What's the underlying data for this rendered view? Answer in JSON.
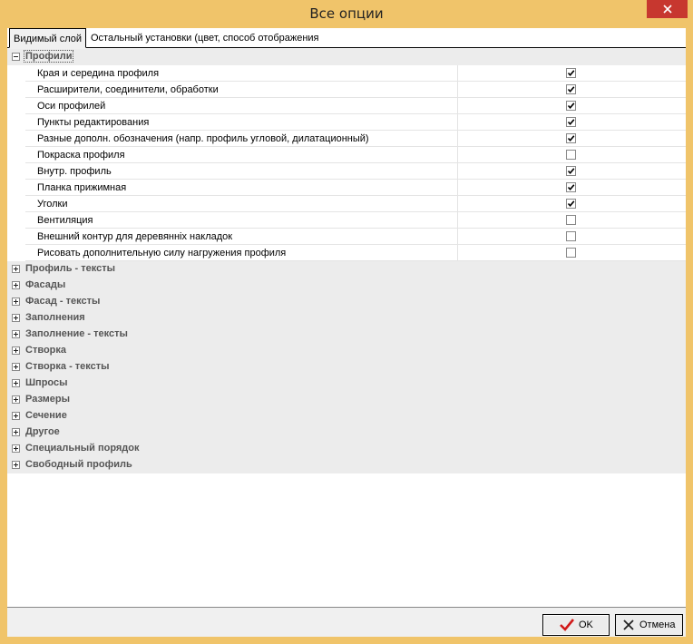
{
  "window": {
    "title": "Все опции"
  },
  "tabs": [
    {
      "label": "Видимый слой",
      "active": true
    },
    {
      "label": "Остальный установки (цвет, способ отображения",
      "active": false
    }
  ],
  "tree": {
    "expanded_group": {
      "label": "Профили",
      "items": [
        {
          "label": "Края и середина профиля",
          "checked": true
        },
        {
          "label": "Расширители, соединители, обработки",
          "checked": true
        },
        {
          "label": "Оси профилей",
          "checked": true
        },
        {
          "label": "Пункты редактирования",
          "checked": true
        },
        {
          "label": "Разные дополн. обозначения (напр. профиль угловой, дилатационный)",
          "checked": true
        },
        {
          "label": "Покраска профиля",
          "checked": false
        },
        {
          "label": "Внутр. профиль",
          "checked": true
        },
        {
          "label": "Планка прижимная",
          "checked": true
        },
        {
          "label": "Уголки",
          "checked": true
        },
        {
          "label": "Вентиляция",
          "checked": false
        },
        {
          "label": "Внешний контур для деревянніх накладок",
          "checked": false
        },
        {
          "label": "Рисовать дополнительную силу нагружения профиля",
          "checked": false
        }
      ]
    },
    "collapsed_groups": [
      "Профиль - тексты",
      "Фасады",
      "Фасад - тексты",
      "Заполнения",
      "Заполнение - тексты",
      "Створка",
      "Створка - тексты",
      "Шпросы",
      "Размеры",
      "Сечение",
      "Другое",
      "Специальный порядок",
      "Свободный профиль"
    ]
  },
  "buttons": {
    "ok": "OK",
    "cancel": "Отмена"
  },
  "colors": {
    "title_bar": "#f0c46a",
    "close_button": "#c7372f",
    "ok_check": "#d11a1a"
  }
}
